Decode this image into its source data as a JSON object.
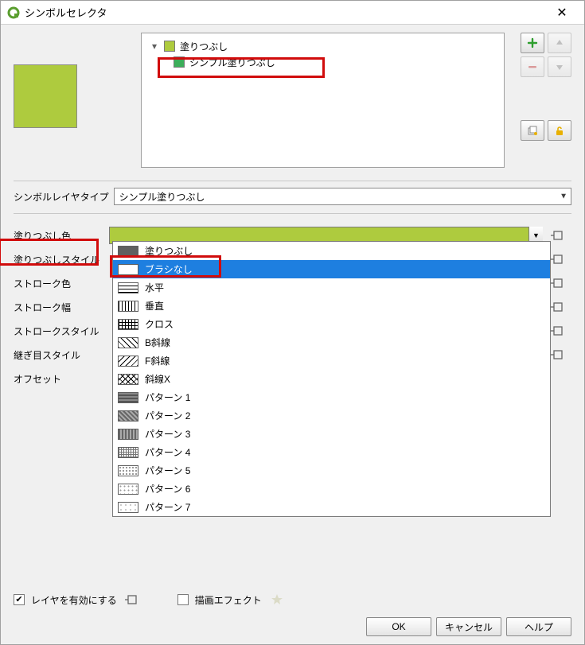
{
  "window": {
    "title": "シンボルセレクタ"
  },
  "tree": {
    "root_label": "塗りつぶし",
    "child_label": "シンプル塗りつぶし"
  },
  "symbol_layer_type": {
    "label": "シンボルレイヤタイプ",
    "value": "シンプル塗りつぶし"
  },
  "labels": {
    "fill_color": "塗りつぶし色",
    "fill_style": "塗りつぶしスタイル",
    "stroke_color": "ストローク色",
    "stroke_width": "ストローク幅",
    "stroke_style": "ストロークスタイル",
    "join_style": "継ぎ目スタイル",
    "offset": "オフセット"
  },
  "colors": {
    "fill": "#aecb3e"
  },
  "fill_style_options": [
    {
      "label": "塗りつぶし",
      "pat": "pat-solid"
    },
    {
      "label": "ブラシなし",
      "pat": "pat-none",
      "selected": true
    },
    {
      "label": "水平",
      "pat": "pat-horiz"
    },
    {
      "label": "垂直",
      "pat": "pat-vert"
    },
    {
      "label": "クロス",
      "pat": "pat-cross"
    },
    {
      "label": "B斜線",
      "pat": "pat-bdiag"
    },
    {
      "label": "F斜線",
      "pat": "pat-fdiag"
    },
    {
      "label": "斜線X",
      "pat": "pat-xdiag"
    },
    {
      "label": "パターン 1",
      "pat": "pat-d1"
    },
    {
      "label": "パターン 2",
      "pat": "pat-d2"
    },
    {
      "label": "パターン 3",
      "pat": "pat-d3"
    },
    {
      "label": "パターン 4",
      "pat": "pat-d4"
    },
    {
      "label": "パターン 5",
      "pat": "pat-d5"
    },
    {
      "label": "パターン 6",
      "pat": "pat-d6"
    },
    {
      "label": "パターン 7",
      "pat": "pat-d7"
    }
  ],
  "footer": {
    "enable_layer": "レイヤを有効にする",
    "draw_effects": "描画エフェクト"
  },
  "buttons": {
    "ok": "OK",
    "cancel": "キャンセル",
    "help": "ヘルプ"
  }
}
